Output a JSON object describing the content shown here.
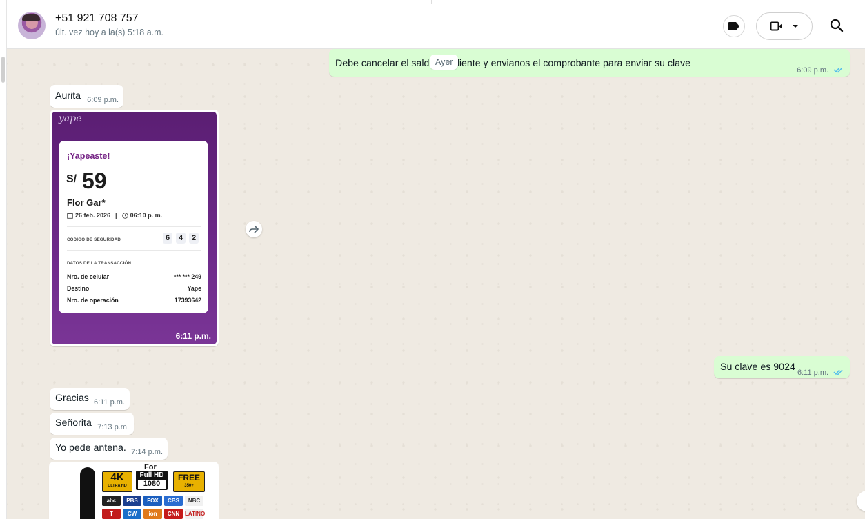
{
  "contact": {
    "name": "+51 921 708 757",
    "last_seen": "últ. vez hoy a la(s) 5:18 a.m."
  },
  "header_icons": {
    "label": "label-icon",
    "video": "video-call-icon",
    "dropdown": "chevron-down-icon",
    "search": "search-icon"
  },
  "date_chip": "Ayer",
  "messages": [
    {
      "id": "m1",
      "dir": "out",
      "text": "Debe cancelar el saldo pendiente y envianos el comprobante para enviar su clave",
      "time": "6:09 p.m."
    },
    {
      "id": "m2",
      "dir": "in",
      "text": "Aurita",
      "time": "6:09 p.m."
    },
    {
      "id": "m3",
      "dir": "out",
      "text": "Su clave es 9024",
      "time": "6:11 p.m."
    },
    {
      "id": "m4",
      "dir": "in",
      "text": "Gracias",
      "time": "6:11 p.m."
    },
    {
      "id": "m5",
      "dir": "in",
      "text": "Señorita",
      "time": "7:13 p.m."
    },
    {
      "id": "m6",
      "dir": "in",
      "text": "Yo pede antena.",
      "time": "7:14 p.m."
    }
  ],
  "yape": {
    "logo": "yape",
    "title": "¡Yapeaste!",
    "currency": "S/",
    "amount": "59",
    "recipient": "Flor Gar*",
    "date": "26 feb. 2026",
    "separator": "|",
    "hour": "06:10 p. m.",
    "security_label": "CÓDIGO DE SEGURIDAD",
    "security_digits": [
      "6",
      "4",
      "2"
    ],
    "data_label": "DATOS DE LA TRANSACCIÓN",
    "rows": [
      {
        "label": "Nro. de celular",
        "value": "*** *** 249"
      },
      {
        "label": "Destino",
        "value": "Yape"
      },
      {
        "label": "Nro. de operación",
        "value": "17393642"
      }
    ],
    "time": "6:11 p.m."
  },
  "tv_image": {
    "for_label": "For",
    "badge_4k": "4K",
    "badge_4k_sub": "ULTRA HD",
    "badge_fullhd": "Full HD",
    "badge_fullhd_num": "1080",
    "badge_free": "FREE",
    "badge_free_sub": "350+",
    "logos": [
      "abc",
      "PBS",
      "FOX",
      "CBS",
      "NBC",
      "T",
      "CW",
      "ion",
      "CNN",
      "LATINO"
    ]
  },
  "colors": {
    "accent_tick": "#53bdeb",
    "out_bubble": "#d9fdd3",
    "yape_purple": "#6d2a8a"
  }
}
